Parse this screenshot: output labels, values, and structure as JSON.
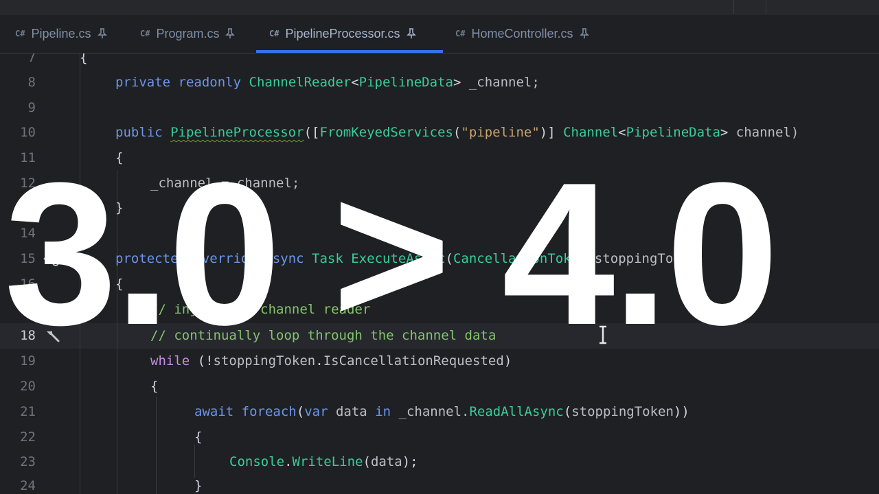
{
  "tabs": [
    {
      "lang": "C#",
      "label": "Pipeline.cs",
      "active": false
    },
    {
      "lang": "C#",
      "label": "Program.cs",
      "active": false
    },
    {
      "lang": "C#",
      "label": "PipelineProcessor.cs",
      "active": true
    },
    {
      "lang": "C#",
      "label": "HomeController.cs",
      "active": false
    }
  ],
  "editor": {
    "current_line": "18",
    "lines": [
      {
        "n": "7",
        "parts": [
          "{"
        ]
      },
      {
        "n": "8",
        "parts": [
          "private",
          " ",
          "readonly",
          " ",
          "ChannelReader",
          "<",
          "PipelineData",
          ">",
          " _channel;"
        ]
      },
      {
        "n": "9",
        "parts": []
      },
      {
        "n": "10",
        "parts": [
          "public",
          " ",
          "PipelineProcessor",
          "([",
          "FromKeyedServices",
          "(",
          "\"pipeline\"",
          ")] ",
          "Channel",
          "<",
          "PipelineData",
          ">",
          " channel)"
        ]
      },
      {
        "n": "11",
        "parts": [
          "{"
        ]
      },
      {
        "n": "12",
        "parts": [
          "_channel = channel;"
        ]
      },
      {
        "n": "13",
        "parts": [
          "}"
        ]
      },
      {
        "n": "14",
        "parts": []
      },
      {
        "n": "15",
        "parts": [
          "protected",
          " ",
          "override",
          " ",
          "async",
          " ",
          "Task",
          " ",
          "ExecuteAsync",
          "(",
          "CancellationToken",
          " stoppingToken)"
        ]
      },
      {
        "n": "16",
        "parts": [
          "{"
        ]
      },
      {
        "n": "17",
        "parts": [
          "// inject the channel reader"
        ]
      },
      {
        "n": "18",
        "parts": [
          "// continually loop through the channel data"
        ]
      },
      {
        "n": "19",
        "parts": [
          "while",
          " (!",
          "stoppingToken",
          ".",
          "IsCancellationRequested",
          ")"
        ]
      },
      {
        "n": "20",
        "parts": [
          "{"
        ]
      },
      {
        "n": "21",
        "parts": [
          "await",
          " ",
          "foreach",
          "(",
          "var",
          " ",
          "data",
          " ",
          "in",
          " _channel.",
          "ReadAllAsync",
          "(",
          "stoppingToken",
          "))"
        ]
      },
      {
        "n": "22",
        "parts": [
          "{"
        ]
      },
      {
        "n": "23",
        "parts": [
          "Console",
          ".",
          "WriteLine",
          "(",
          "data",
          ");"
        ]
      },
      {
        "n": "24",
        "parts": [
          "}"
        ]
      }
    ]
  },
  "overlay": {
    "text": "3.0 > 4.0"
  },
  "icons": {
    "tab_pin": "pin-icon",
    "gutter_15": "override-method-icon",
    "gutter_18": "quick-action-hammer-icon",
    "cursor": "text-cursor-icon"
  },
  "colors": {
    "background": "#1f2023",
    "accent": "#3574f0",
    "keyword": "#6c95eb",
    "type": "#39cc9b",
    "string": "#c9a26d",
    "comment": "#85c46c",
    "control": "#c58ede"
  }
}
